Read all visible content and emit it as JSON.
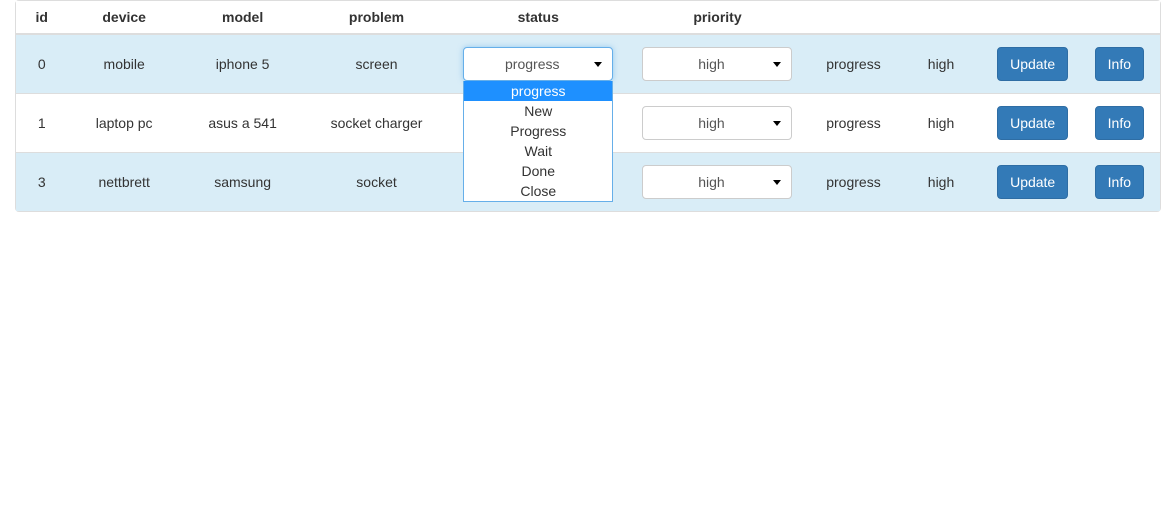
{
  "headers": {
    "id": "id",
    "device": "device",
    "model": "model",
    "problem": "problem",
    "status": "status",
    "priority": "priority"
  },
  "rows": [
    {
      "id": "0",
      "device": "mobile",
      "model": "iphone 5",
      "problem": "screen",
      "status_select": "progress",
      "priority_select": "high",
      "status_text": "progress",
      "priority_text": "high"
    },
    {
      "id": "1",
      "device": "laptop pc",
      "model": "asus a 541",
      "problem": "socket charger",
      "status_select": "",
      "priority_select": "high",
      "status_text": "progress",
      "priority_text": "high"
    },
    {
      "id": "3",
      "device": "nettbrett",
      "model": "samsung",
      "problem": "socket",
      "status_select": "",
      "priority_select": "high",
      "status_text": "progress",
      "priority_text": "high"
    }
  ],
  "status_options": [
    "progress",
    "New",
    "Progress",
    "Wait",
    "Done",
    "Close"
  ],
  "status_dropdown_open_row": 0,
  "buttons": {
    "update": "Update",
    "info": "Info"
  }
}
